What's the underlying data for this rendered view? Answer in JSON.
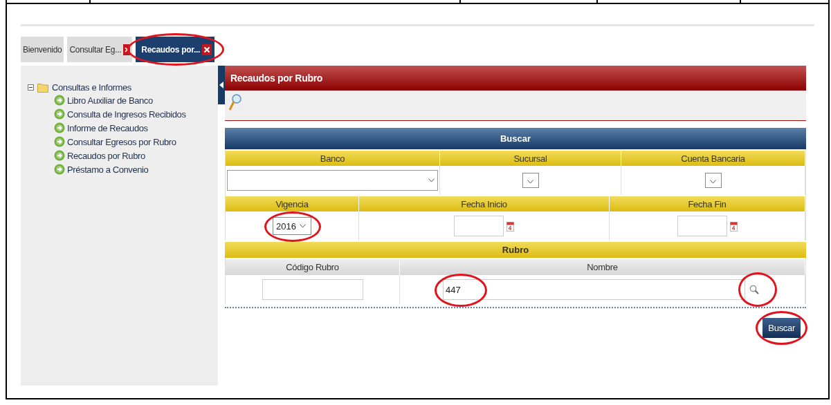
{
  "tabs": [
    {
      "label": "Bienvenido",
      "selected": false,
      "closable": false,
      "highlighted": false
    },
    {
      "label": "Consultar Eg...",
      "selected": false,
      "closable": true,
      "highlighted": false
    },
    {
      "label": "Recaudos por...",
      "selected": true,
      "closable": true,
      "highlighted": true
    }
  ],
  "tree": {
    "label": "Consultas e Informes",
    "expanded": true,
    "children": [
      {
        "label": "Libro Auxiliar de Banco"
      },
      {
        "label": "Consulta de Ingresos Recibidos"
      },
      {
        "label": "Informe de Recaudos"
      },
      {
        "label": "Consultar Egresos por Rubro"
      },
      {
        "label": "Recaudos por Rubro"
      },
      {
        "label": "Préstamo a Convenio"
      }
    ]
  },
  "panel": {
    "title": "Recaudos por Rubro"
  },
  "form": {
    "title": "Buscar",
    "bank_fields": [
      {
        "label": "Banco",
        "kind": "select"
      },
      {
        "label": "Sucursal",
        "kind": "small-select"
      },
      {
        "label": "Cuenta Bancaria",
        "kind": "small-select"
      }
    ],
    "period_fields": [
      {
        "label": "Vigencia",
        "kind": "select",
        "value": "2016",
        "highlighted": true
      },
      {
        "label": "Fecha Inicio",
        "kind": "date",
        "highlighted": false
      },
      {
        "label": "Fecha Fin",
        "kind": "date",
        "highlighted": false
      }
    ],
    "rubro": {
      "title": "Rubro",
      "fields": [
        {
          "label": "Código Rubro",
          "kind": "text",
          "highlighted": false
        },
        {
          "label": "Nombre",
          "kind": "lookup",
          "value": "447",
          "highlighted": true,
          "button_highlighted": true
        }
      ]
    }
  },
  "submit": {
    "label": "Buscar",
    "highlighted": true
  }
}
